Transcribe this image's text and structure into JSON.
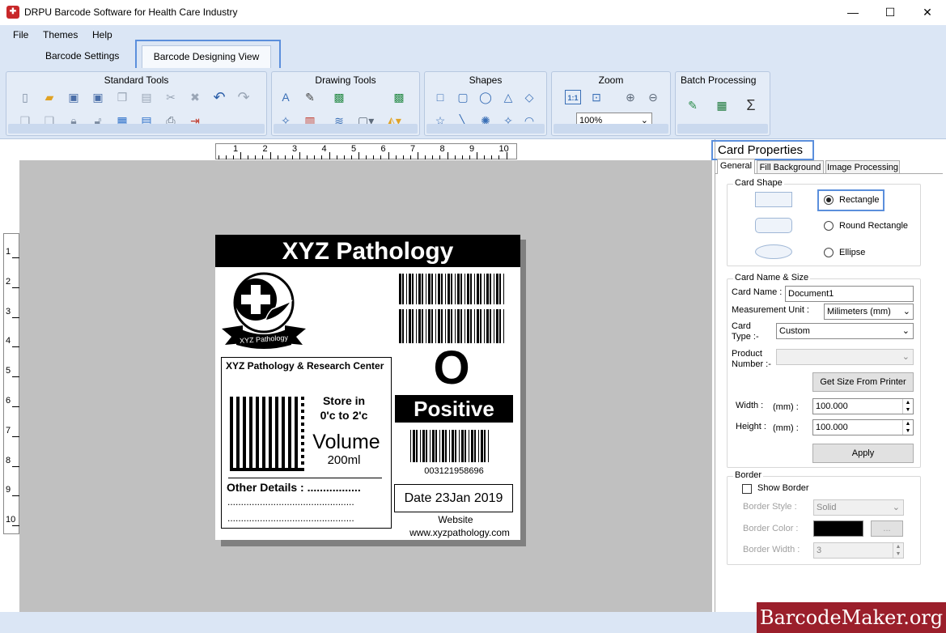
{
  "window": {
    "title": "DRPU Barcode Software for Health Care Industry",
    "minimize": "—",
    "maximize": "☐",
    "close": "✕"
  },
  "menu": {
    "file": "File",
    "themes": "Themes",
    "help": "Help"
  },
  "tabs": {
    "settings": "Barcode Settings",
    "design": "Barcode Designing View"
  },
  "ribbon": {
    "groups": {
      "standard": "Standard Tools",
      "drawing": "Drawing Tools",
      "shapes": "Shapes",
      "zoom": "Zoom",
      "batch": "Batch Processing"
    },
    "zoom_value": "100%",
    "zoom_fit": "1:1"
  },
  "rulers": {
    "h": [
      "1",
      "2",
      "3",
      "4",
      "5",
      "6",
      "7",
      "8",
      "9",
      "10"
    ],
    "v": [
      "1",
      "2",
      "3",
      "4",
      "5",
      "6",
      "7",
      "8",
      "9",
      "10"
    ]
  },
  "card": {
    "header": "XYZ Pathology",
    "logo_text": "XYZ Pathology",
    "company": "XYZ Pathology & Research Center",
    "store_line1": "Store in",
    "store_line2": "0'c to 2'c",
    "volume_label": "Volume",
    "volume_value": "200ml",
    "other_details": "Other Details : .................",
    "dots1": "...............................................",
    "dots2": "...............................................",
    "blood_group": "O",
    "rh": "Positive",
    "barcode_number": "003121958696",
    "date": "Date 23Jan 2019",
    "website_label": "Website",
    "website": "www.xyzpathology.com"
  },
  "properties": {
    "title": "Card Properties",
    "tabs": [
      "General",
      "Fill Background",
      "Image Processing"
    ],
    "card_shape": {
      "legend": "Card Shape",
      "rectangle": "Rectangle",
      "round_rectangle": "Round Rectangle",
      "ellipse": "Ellipse",
      "selected": "Rectangle"
    },
    "name_size": {
      "legend": "Card  Name & Size",
      "card_name_label": "Card Name :",
      "card_name_value": "Document1",
      "measurement_label": "Measurement Unit :",
      "measurement_value": "Milimeters (mm)",
      "card_type_label_1": "Card",
      "card_type_label_2": "Type :-",
      "card_type_value": "Custom",
      "product_label_1": "Product",
      "product_label_2": "Number :-",
      "product_value": "",
      "get_size_button": "Get Size From Printer",
      "width_label": "Width :",
      "height_label": "Height :",
      "unit": "(mm) :",
      "width_value": "100.000",
      "height_value": "100.000",
      "apply_button": "Apply"
    },
    "border": {
      "legend": "Border",
      "show_border": "Show Border",
      "style_label": "Border Style :",
      "style_value": "Solid",
      "color_label": "Border Color :",
      "color_value": "#000000",
      "color_button": "...",
      "width_label": "Border Width :",
      "width_value": "3"
    }
  },
  "watermark": "BarcodeMaker.org"
}
